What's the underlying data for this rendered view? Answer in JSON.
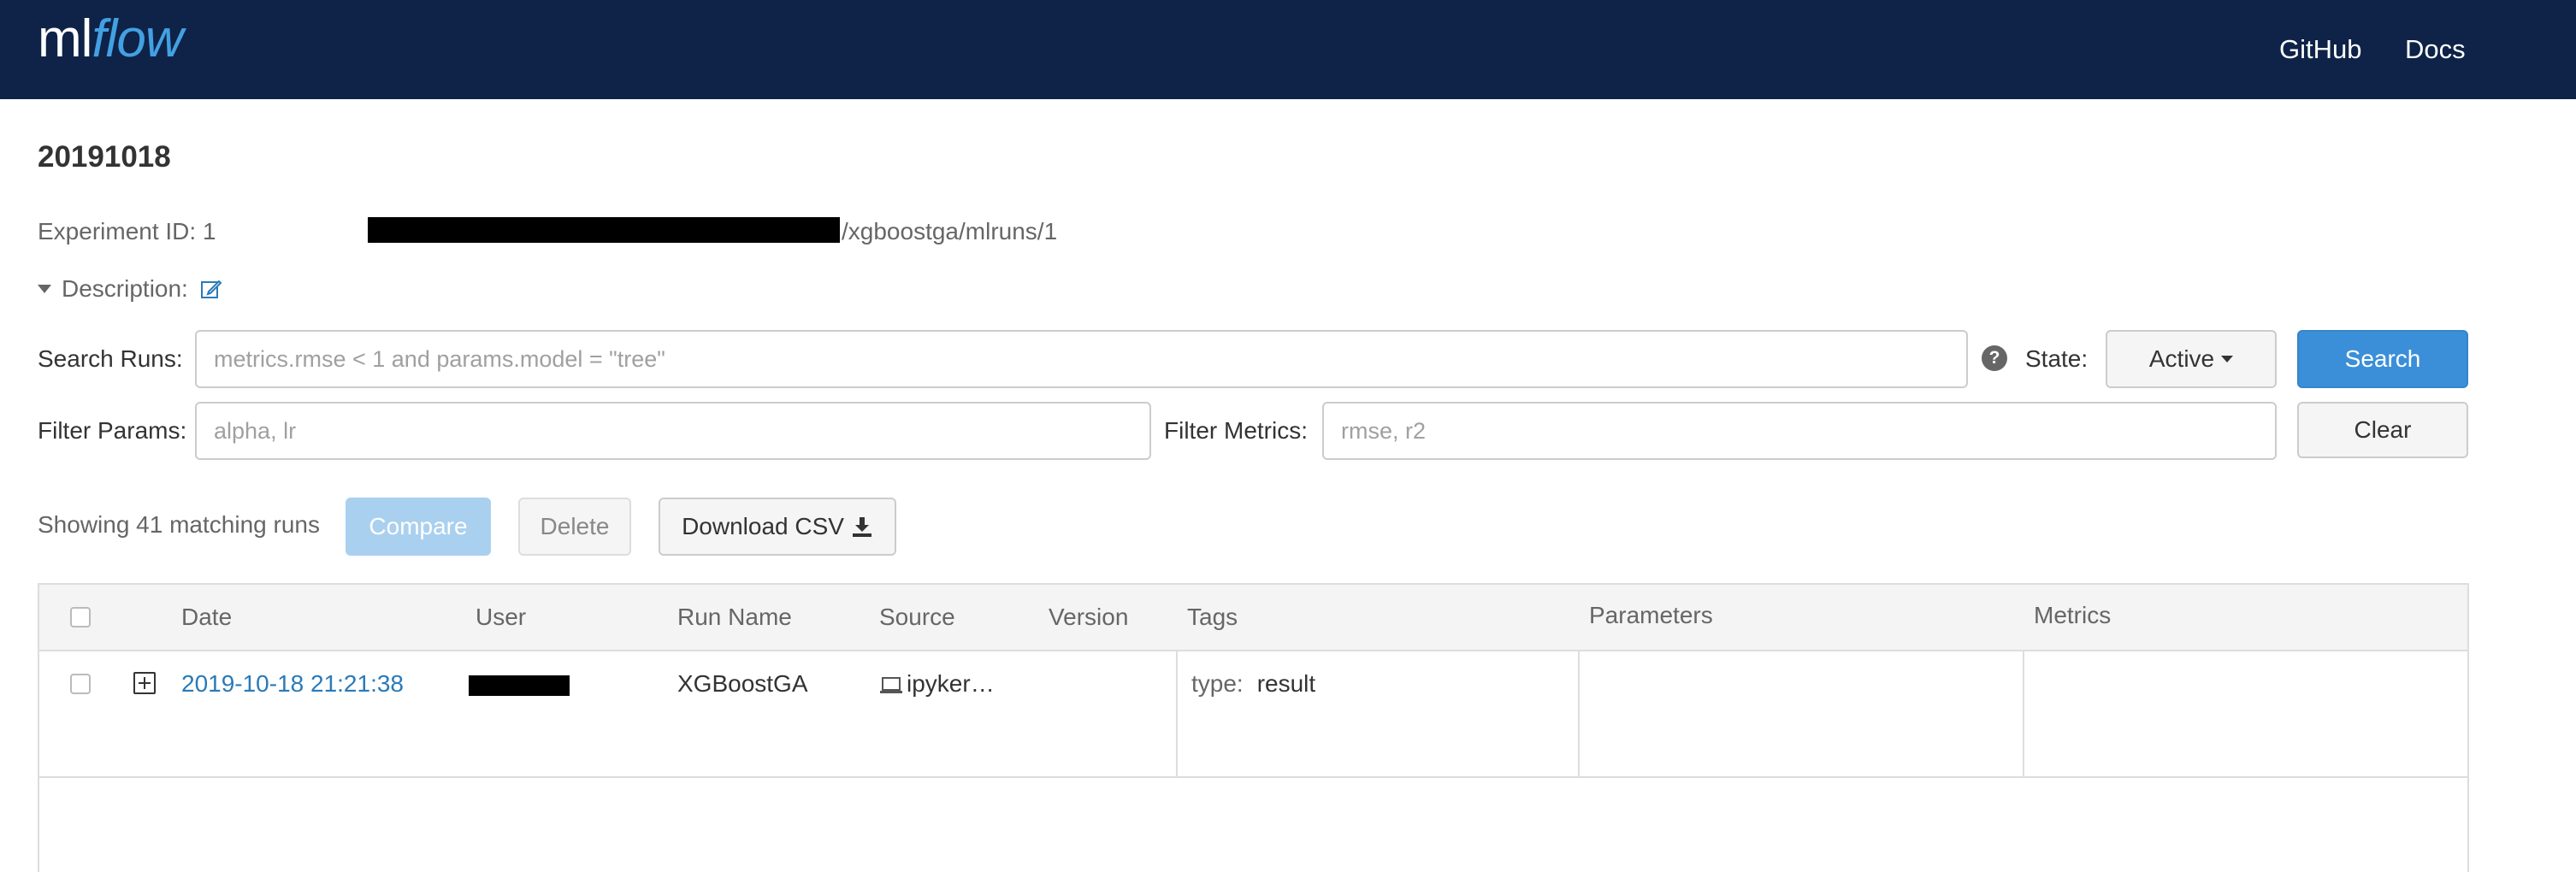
{
  "header": {
    "logo_ml": "ml",
    "logo_flow": "flow",
    "nav": {
      "github": "GitHub",
      "docs": "Docs"
    }
  },
  "experiment": {
    "title": "20191018",
    "id_label": "Experiment ID: 1",
    "artifact_location_visible": "/xgboostga/mlruns/1",
    "description_label": "Description:"
  },
  "search": {
    "runs_label": "Search Runs:",
    "runs_placeholder": "metrics.rmse < 1 and params.model = \"tree\"",
    "help_glyph": "?",
    "state_label": "State:",
    "state_value": "Active",
    "search_button": "Search",
    "filter_params_label": "Filter Params:",
    "filter_params_placeholder": "alpha, lr",
    "filter_metrics_label": "Filter Metrics:",
    "filter_metrics_placeholder": "rmse, r2",
    "clear_button": "Clear"
  },
  "runs_toolbar": {
    "showing_text": "Showing 41 matching runs",
    "compare_button": "Compare",
    "delete_button": "Delete",
    "download_button": "Download CSV"
  },
  "table": {
    "headers": {
      "date": "Date",
      "user": "User",
      "run_name": "Run Name",
      "source": "Source",
      "version": "Version",
      "tags": "Tags",
      "parameters": "Parameters",
      "metrics": "Metrics"
    },
    "rows": [
      {
        "date": "2019-10-18 21:21:38",
        "run_name": "XGBoostGA",
        "source": "ipyker…",
        "version": "",
        "tag_key": "type:",
        "tag_value": "result"
      }
    ]
  },
  "colors": {
    "header_bg": "#0e2347",
    "accent_blue": "#3b8fd9",
    "link_blue": "#2a7ab8",
    "logo_flow": "#43a0e3"
  },
  "icons": {
    "description_toggle": "caret-down-icon",
    "edit": "edit-icon",
    "help": "question-circle-icon",
    "state_dropdown": "caret-down-icon",
    "download": "download-icon",
    "expand_row": "plus-square-icon",
    "source": "laptop-icon"
  }
}
